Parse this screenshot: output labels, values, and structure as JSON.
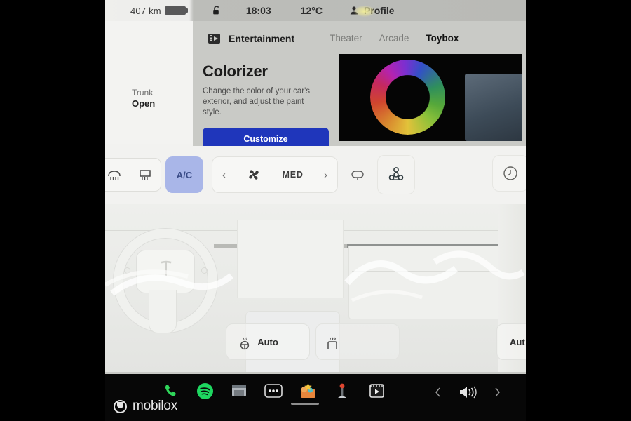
{
  "status_bar": {
    "range": "407 km",
    "lock_icon": "unlocked-padlock-icon",
    "time": "18:03",
    "temperature": "12°C",
    "profile_label": "Profile",
    "profile_icon": "person-icon"
  },
  "left_panel": {
    "trunk_label": "Trunk",
    "trunk_state": "Open"
  },
  "entertainment": {
    "app_icon": "film-strip-icon",
    "app_title": "Entertainment",
    "tabs": [
      {
        "label": "Theater",
        "active": false
      },
      {
        "label": "Arcade",
        "active": false
      },
      {
        "label": "Toybox",
        "active": true
      }
    ],
    "card": {
      "title": "Colorizer",
      "description": "Change the color of your car's exterior, and adjust the paint style.",
      "button_label": "Customize",
      "button_color": "#1f36bb",
      "preview_icon": "color-wheel-icon"
    }
  },
  "climate_bar": {
    "front_defrost_icon": "front-defrost-icon",
    "rear_defrost_icon": "rear-defrost-icon",
    "ac_label": "A/C",
    "ac_active_color": "#a9b6e8",
    "fan_prev_label": "‹",
    "fan_icon": "fan-icon",
    "fan_level": "MED",
    "fan_next_label": "›",
    "recirculate_icon": "recirculate-icon",
    "bioweapon_icon": "biohazard-icon",
    "timer_icon": "clock-icon"
  },
  "car_view": {
    "illustration": "tesla-interior-dashboard",
    "brand_mark": "tesla-t-logo"
  },
  "auto_controls": {
    "left_auto_label": "Auto",
    "right_auto_label": "Aut",
    "heated_wheel_icon": "heated-steering-wheel-icon",
    "heated_seat_icon": "heated-seat-icon"
  },
  "dock": {
    "apps": [
      {
        "name": "phone-app-icon",
        "label": "Phone",
        "color": "#2fd65a"
      },
      {
        "name": "spotify-app-icon",
        "label": "Spotify",
        "color": "#1ed760"
      },
      {
        "name": "calendar-app-icon",
        "label": "Calendar",
        "color": "#9aa2ab"
      },
      {
        "name": "more-apps-icon",
        "label": "More",
        "color": "#ffffff"
      },
      {
        "name": "toybox-app-icon",
        "label": "Toybox",
        "color": "#f5c63c"
      },
      {
        "name": "arcade-app-icon",
        "label": "Arcade",
        "color": "#e0452f"
      },
      {
        "name": "theater-app-icon",
        "label": "Theater",
        "color": "#ffffff"
      }
    ],
    "volume": {
      "prev_icon": "chevron-left-icon",
      "speaker_icon": "speaker-icon",
      "next_icon": "chevron-right-icon"
    }
  },
  "watermark": {
    "text": "mobilox",
    "logo": "mobilox-logo-icon"
  }
}
